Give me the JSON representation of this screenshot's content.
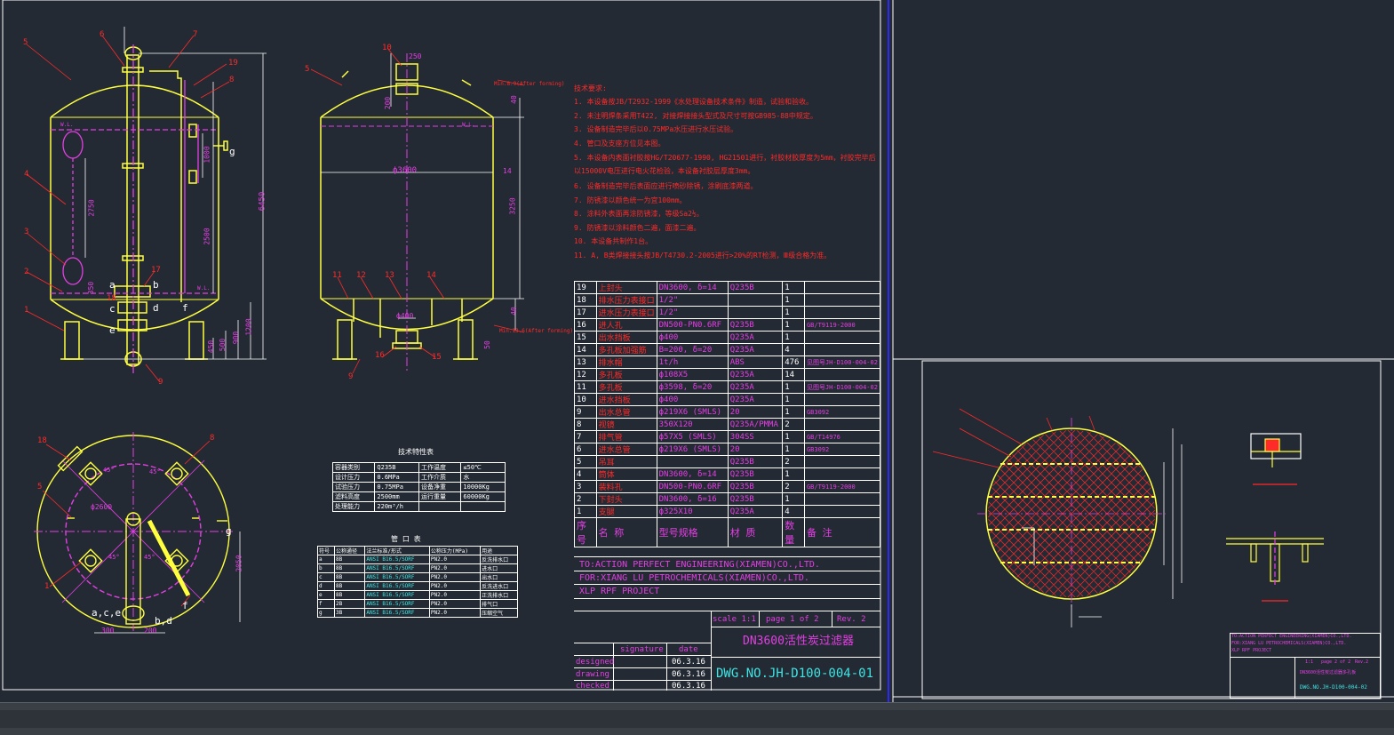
{
  "tech_notes": {
    "heading": "技术要求:",
    "lines": [
      "1. 本设备按JB/T2932-1999《水处理设备技术条件》制造，试验和验收。",
      "2. 未注明焊条采用T422, 对接焊接接头型式及尺寸可按GB985-88中规定。",
      "3. 设备制造完毕后以0.75MPa水压进行水压试验。",
      "4. 管口及支座方位见本图。",
      "5. 本设备内表面衬胶按HG/T20677-1990, HG21501进行，衬胶材胶厚度为5mm，衬胶完毕后",
      "以15000V电压进行电火花检验，本设备衬胶层厚度3mm。",
      "6. 设备制造完毕后表面应进行喷砂除锈，涂刷底漆两道。",
      "7. 防锈漆以颜色统一为宜100mm。",
      "8. 涂料外表面再涂防锈漆，等级Sa2½。",
      "9. 防锈漆以涂料颜色二遍，面漆二遍。",
      "10. 本设备共制作1台。",
      "11. A, B类焊接接头按JB/T4730.2-2005进行>20%的RT检测，Ⅲ级合格为准。"
    ]
  },
  "dims": {
    "height_total": "6450",
    "d2750": "2750",
    "d2500": "2500",
    "d1000": "1000",
    "d1200": "1200",
    "d900": "900",
    "d450": "450",
    "d500": "500",
    "d350": "350",
    "d250": "250",
    "d3600": "ф3600",
    "d3250": "3250",
    "d40a": "40",
    "d40b": "40",
    "d200": "200",
    "d50": "50",
    "d14": "14",
    "d16": "16",
    "d400": "ф400",
    "d2600": "ф2600",
    "d2050": "2050",
    "d300": "300",
    "dim_note_top": "Min.8.9(After forming)",
    "dim_note_bot": "Min.13.6(After forming)",
    "wl": "W.L.",
    "nozzle_letters": [
      "a",
      "b",
      "c",
      "d",
      "e",
      "f",
      "g"
    ],
    "label_acE": "a,c,e",
    "label_bd": "b,d",
    "angle45": "45°"
  },
  "callouts": [
    "1",
    "2",
    "3",
    "4",
    "5",
    "6",
    "7",
    "8",
    "9",
    "10",
    "11",
    "12",
    "13",
    "14",
    "15",
    "16",
    "17",
    "18",
    "19"
  ],
  "tech_char": {
    "title": "技术特性表",
    "rows": [
      [
        "容器类别",
        "Q235B",
        "工作温度",
        "≤50℃"
      ],
      [
        "设计压力",
        "0.6MPa",
        "工作介质",
        "水"
      ],
      [
        "试验压力",
        "0.75MPa",
        "设备净重",
        "10000Kg"
      ],
      [
        "滤料高度",
        "2500mm",
        "运行重量",
        "60000Kg"
      ],
      [
        "处理能力",
        "220m³/h",
        "",
        ""
      ]
    ]
  },
  "nozzle_table": {
    "title": "管  口  表",
    "headers": [
      "符号",
      "公称通径",
      "法兰标准/形式",
      "公称压力(MPa)",
      "用途"
    ],
    "rows": [
      [
        "a",
        "8B",
        "ANSI B16.5/SORF",
        "PN2.0",
        "反洗排水口"
      ],
      [
        "b",
        "8B",
        "ANSI B16.5/SORF",
        "PN2.0",
        "进水口"
      ],
      [
        "c",
        "8B",
        "ANSI B16.5/SORF",
        "PN2.0",
        "出水口"
      ],
      [
        "d",
        "8B",
        "ANSI B16.5/SORF",
        "PN2.0",
        "反洗进水口"
      ],
      [
        "e",
        "8B",
        "ANSI B16.5/SORF",
        "PN2.0",
        "正洗排水口"
      ],
      [
        "f",
        "2B",
        "ANSI B16.5/SORF",
        "PN2.0",
        "排气口"
      ],
      [
        "g",
        "3B",
        "ANSI B16.5/SORF",
        "PN2.0",
        "压缩空气"
      ]
    ]
  },
  "bom": {
    "rows": [
      [
        "19",
        "上封头",
        "DN3600, δ=14",
        "Q235B",
        "1",
        ""
      ],
      [
        "18",
        "排水压力表接口",
        "1/2\"",
        "",
        "1",
        ""
      ],
      [
        "17",
        "进水压力表接口",
        "1/2\"",
        "",
        "1",
        ""
      ],
      [
        "16",
        "进人孔",
        "DN500-PN0.6RF",
        "Q235B",
        "1",
        "GB/T9119-2000"
      ],
      [
        "15",
        "出水挡板",
        "ф400",
        "Q235A",
        "1",
        ""
      ],
      [
        "14",
        "多孔板加强筋",
        "B=200, δ=20",
        "Q235A",
        "4",
        ""
      ],
      [
        "13",
        "排水帽",
        "1t/h",
        "ABS",
        "476",
        "见图号JH-D100-004-02"
      ],
      [
        "12",
        "多孔板",
        "ф108X5",
        "Q235A",
        "14",
        ""
      ],
      [
        "11",
        "多孔板",
        "ф3598, δ=20",
        "Q235A",
        "1",
        "见图号JH-D100-004-02"
      ],
      [
        "10",
        "进水挡板",
        "ф400",
        "Q235A",
        "1",
        ""
      ],
      [
        "9",
        "出水总管",
        "ф219X6 (SMLS)",
        "20",
        "1",
        "GB3092"
      ],
      [
        "8",
        "视镜",
        "350X120",
        "Q235A/PMMA",
        "2",
        ""
      ],
      [
        "7",
        "排气管",
        "ф57X5 (SMLS)",
        "304SS",
        "1",
        "GB/T14976"
      ],
      [
        "6",
        "进水总管",
        "ф219X6 (SMLS)",
        "20",
        "1",
        "GB3092"
      ],
      [
        "5",
        "吊耳",
        "",
        "Q235B",
        "2",
        ""
      ],
      [
        "4",
        "筒体",
        "DN3600, δ=14",
        "Q235B",
        "1",
        ""
      ],
      [
        "3",
        "装料孔",
        "DN500-PN0.6RF",
        "Q235B",
        "2",
        "GB/T9119-2000"
      ],
      [
        "2",
        "下封头",
        "DN3600, δ=16",
        "Q235B",
        "1",
        ""
      ],
      [
        "1",
        "支腿",
        "ф325X10",
        "Q235A",
        "4",
        ""
      ]
    ],
    "header": [
      "序号",
      "名    称",
      "型号规格",
      "材  质",
      "数量",
      "备  注"
    ]
  },
  "title_block": {
    "to": "TO:ACTION PERFECT ENGINEERING(XIAMEN)CO.,LTD.",
    "for": "FOR:XIANG LU PETROCHEMICALS(XIAMEN)CO.,LTD.",
    "project": "XLP RPF PROJECT",
    "scale": "scale 1:1",
    "page": "page 1 of 2",
    "rev": "Rev. 2",
    "title": "DN3600活性炭过滤器",
    "dwg": "DWG.NO.JH-D100-004-01",
    "sig_header": [
      "",
      "signature",
      "date"
    ],
    "sig_rows": [
      [
        "designed",
        "",
        "06.3.16"
      ],
      [
        "drawing",
        "",
        "06.3.16"
      ],
      [
        "checked",
        "",
        "06.3.16"
      ]
    ]
  },
  "mini_title": {
    "to": "TO:ACTION PERFECT ENGINEERING(XIAMEN)CO.,LTD.",
    "for": "FOR:XIANG LU PETROCHEMICALS(XIAMEN)CO.,LTD.",
    "project": "XLP RPF PROJECT",
    "scale": "1:1",
    "page": "page 2 of 2",
    "rev": "Rev.2",
    "title": "DN3600活性炭过滤器多孔板",
    "dwg": "DWG.NO.JH-D100-004-02"
  },
  "colors": {
    "background": "#232a33",
    "outline": "#ffff40",
    "dimension": "#e43fe4",
    "notes": "#ff2a2a",
    "frame": "#2a2aff",
    "cyan": "#3fe4e4"
  }
}
